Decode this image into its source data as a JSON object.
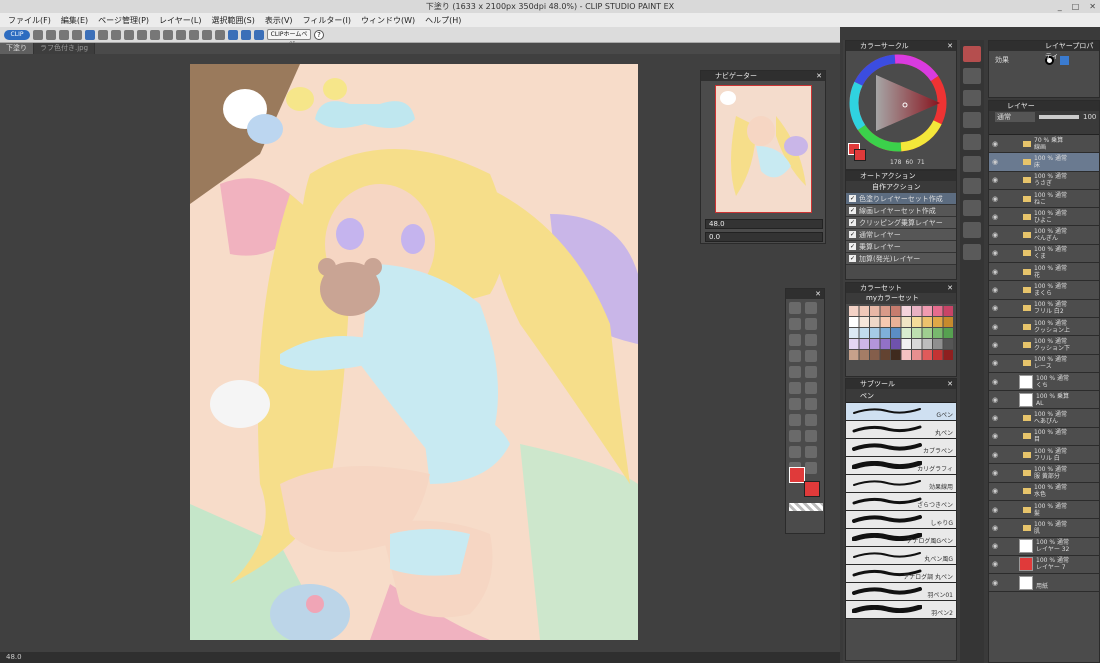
{
  "window": {
    "title": "下塗り (1633 x 2100px 350dpi 48.0%) - CLIP STUDIO PAINT EX",
    "controls": [
      "_",
      "□",
      "✕"
    ]
  },
  "menu": [
    "ファイル(F)",
    "編集(E)",
    "ページ管理(P)",
    "レイヤー(L)",
    "選択範囲(S)",
    "表示(V)",
    "フィルター(I)",
    "ウィンドウ(W)",
    "ヘルプ(H)"
  ],
  "toolbar": {
    "logo_label": "CLIP",
    "home_label": "CLIPホームページ",
    "help_label": "?"
  },
  "doc_tabs": [
    {
      "label": "下塗り",
      "active": true
    },
    {
      "label": "ラフ色付き.jpg",
      "active": false
    }
  ],
  "status": {
    "zoom": "48.0"
  },
  "navigator": {
    "title": "ナビゲーター",
    "zoom_value": "48.0",
    "angle_value": "0.0"
  },
  "color_wheel": {
    "title": "カラーサークル",
    "h": "178",
    "s": "60",
    "v": "71"
  },
  "auto_action": {
    "title": "オートアクション",
    "set_name": "自作アクション",
    "items": [
      "色塗りレイヤーセット作成",
      "線画レイヤーセット作成",
      "クリッピング乗算レイヤー",
      "通常レイヤー",
      "乗算レイヤー",
      "加算(発光)レイヤー"
    ]
  },
  "color_set": {
    "title": "カラーセット",
    "set_name": "myカラーセット"
  },
  "sub_tool": {
    "title": "サブツール",
    "group": "ペン",
    "brushes": [
      "Gペン",
      "丸ペン",
      "カブラペン",
      "カリグラフィ",
      "効果線用",
      "ざらつきペン",
      "しゃりG",
      "アナログ風Gペン",
      "丸ペン風G",
      "アナログ調 丸ペン",
      "羽ペン01",
      "羽ペン2"
    ]
  },
  "layer_property": {
    "title": "レイヤープロパティ",
    "effect_label": "効果"
  },
  "layers": {
    "title": "レイヤー",
    "blend_mode": "通常",
    "opacity": "100",
    "rows": [
      {
        "line1": "70 % 乗算",
        "line2": "線画",
        "kind": "folder"
      },
      {
        "line1": "100 % 通常",
        "line2": "床",
        "kind": "folder"
      },
      {
        "line1": "100 % 通常",
        "line2": "うさぎ",
        "kind": "folder"
      },
      {
        "line1": "100 % 通常",
        "line2": "ねこ",
        "kind": "folder"
      },
      {
        "line1": "100 % 通常",
        "line2": "ひよこ",
        "kind": "folder"
      },
      {
        "line1": "100 % 通常",
        "line2": "ぺんぎん",
        "kind": "folder"
      },
      {
        "line1": "100 % 通常",
        "line2": "くま",
        "kind": "folder"
      },
      {
        "line1": "100 % 通常",
        "line2": "花",
        "kind": "folder"
      },
      {
        "line1": "100 % 通常",
        "line2": "まくら",
        "kind": "folder"
      },
      {
        "line1": "100 % 通常",
        "line2": "フリル 白2",
        "kind": "folder"
      },
      {
        "line1": "100 % 通常",
        "line2": "クッション上",
        "kind": "folder"
      },
      {
        "line1": "100 % 通常",
        "line2": "クッション下",
        "kind": "folder"
      },
      {
        "line1": "100 % 通常",
        "line2": "レース",
        "kind": "folder"
      },
      {
        "line1": "100 % 通常",
        "line2": "くち",
        "kind": "layer"
      },
      {
        "line1": "100 % 乗算",
        "line2": "AL",
        "kind": "layer"
      },
      {
        "line1": "100 % 通常",
        "line2": "へあぴん",
        "kind": "folder"
      },
      {
        "line1": "100 % 通常",
        "line2": "目",
        "kind": "folder"
      },
      {
        "line1": "100 % 通常",
        "line2": "フリル 白",
        "kind": "folder"
      },
      {
        "line1": "100 % 通常",
        "line2": "服 黄部分",
        "kind": "folder"
      },
      {
        "line1": "100 % 通常",
        "line2": "水色",
        "kind": "folder"
      },
      {
        "line1": "100 % 通常",
        "line2": "髪",
        "kind": "folder"
      },
      {
        "line1": "100 % 通常",
        "line2": "肌",
        "kind": "folder"
      },
      {
        "line1": "100 % 通常",
        "line2": "レイヤー 32",
        "kind": "layer"
      },
      {
        "line1": "100 % 通常",
        "line2": "レイヤー 7",
        "kind": "red"
      },
      {
        "line1": "",
        "line2": "用紙",
        "kind": "paper"
      }
    ]
  },
  "colors": {
    "main": "#e03a3a",
    "sub": "#e03a3a",
    "selected_layer": "#6a7a90"
  }
}
